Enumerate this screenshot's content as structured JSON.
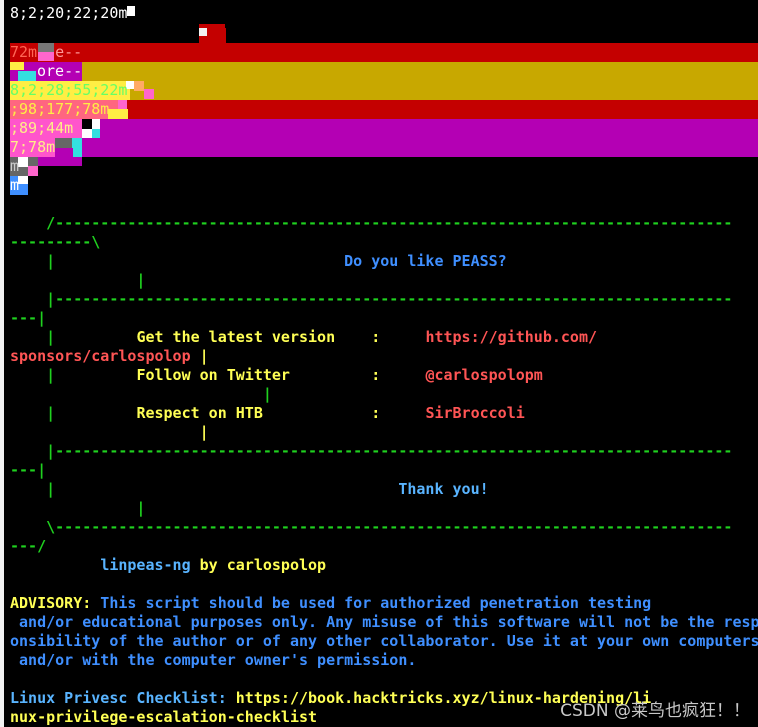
{
  "colors": {
    "background": "#000000",
    "dashes": "#1fd11f",
    "question": "#3f8fff",
    "labels": "#ffff55",
    "values": "#ff5555",
    "red_bar": "#c40000",
    "yellow_bar": "#c8a800",
    "magenta_bar": "#b400b4"
  },
  "top_line": "8;2;20;22;20m",
  "glitch": {
    "line1": "72m",
    "line1b": "e--",
    "line2": "ore--",
    "line3": "8;2;28;55;22m",
    "line4": ";98;177;78m",
    "line5": ";89;44m",
    "line6": "7;78m",
    "line7": "m",
    "line8": "m"
  },
  "banner": {
    "top_a": "    /---------------------------------------------------------------------------",
    "top_b": "---------\\",
    "question_pre": "    |                                ",
    "question": "Do you like PEASS?",
    "pipe_1": "              |",
    "sep1_a": "    |---------------------------------------------------------------------------",
    "sep1_b": "---|",
    "row1_pre": "    |         ",
    "row1_label": "Get the latest version    :",
    "row1_value_a": "https://github.com/",
    "row1_value_b": "sponsors/carlospolop",
    "row1_tail": " |",
    "row2_pre": "    |         ",
    "row2_label": "Follow on Twitter         :",
    "row2_value": "@carlospolopm",
    "pipe_2": "                            |",
    "row3_pre": "    |         ",
    "row3_label": "Respect on HTB            :",
    "row3_value": "SirBroccoli",
    "pipe_3": "                     |",
    "sep2_a": "    |---------------------------------------------------------------------------",
    "sep2_b": "---|",
    "thanks_pre": "    |                                      ",
    "thanks": "Thank you!",
    "pipe_4": "              |",
    "bot_a": "    \\---------------------------------------------------------------------------",
    "bot_b": "---/"
  },
  "credit": {
    "name": "linpeas-ng",
    "by": " by carlospolop"
  },
  "advisory": {
    "label": "ADVISORY:",
    "line1": " This script should be used for authorized penetration testing",
    "line2": " and/or educational purposes only. Any misuse of this software will not be the resp",
    "line3": "onsibility of the author or of any other collaborator. Use it at your own computers",
    "line4": " and/or with the computer owner's permission."
  },
  "checklist": {
    "label": "Linux Privesc Checklist:",
    "url_a": " https://book.hacktricks.xyz/linux-hardening/li",
    "url_b": "nux-privilege-escalation-checklist"
  },
  "watermark": "CSDN @莱鸟也疯狂！！"
}
